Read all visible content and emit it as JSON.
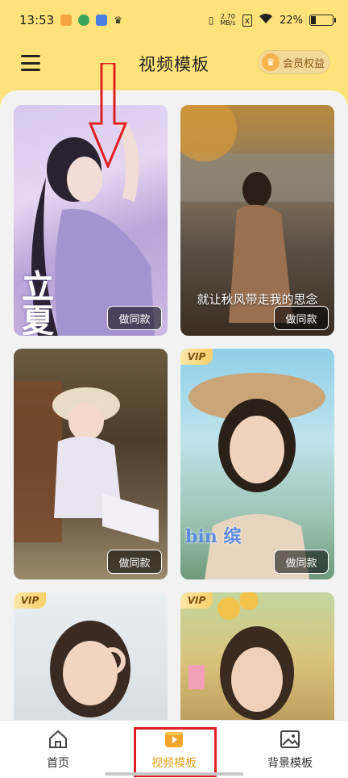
{
  "status_bar": {
    "time": "13:53",
    "net_speed_value": "2.70",
    "net_speed_unit": "MB/s",
    "battery": "22%"
  },
  "header": {
    "title": "视频模板",
    "vip_label": "会员权益",
    "vip_icon": "crown-icon"
  },
  "templates": [
    {
      "caption": "",
      "action": "做同款",
      "vip": "",
      "overlay": "立夏"
    },
    {
      "caption": "就让秋风带走我的思念",
      "action": "做同款",
      "vip": "",
      "overlay": ""
    },
    {
      "caption": "",
      "action": "做同款",
      "vip": "",
      "overlay": ""
    },
    {
      "caption": "",
      "action": "做同款",
      "vip": "VIP",
      "overlay": "bin 缤"
    },
    {
      "caption": "",
      "action": "",
      "vip": "VIP",
      "overlay": ""
    },
    {
      "caption": "",
      "action": "",
      "vip": "VIP",
      "overlay": ""
    }
  ],
  "bottom_nav": {
    "items": [
      {
        "label": "首页",
        "icon": "home-icon"
      },
      {
        "label": "视频模板",
        "icon": "video-template-icon"
      },
      {
        "label": "背景模板",
        "icon": "image-icon"
      }
    ],
    "active_index": 1
  },
  "colors": {
    "header_bg": "#ffe37a",
    "accent": "#e8a21e",
    "annotation": "#e02020"
  }
}
